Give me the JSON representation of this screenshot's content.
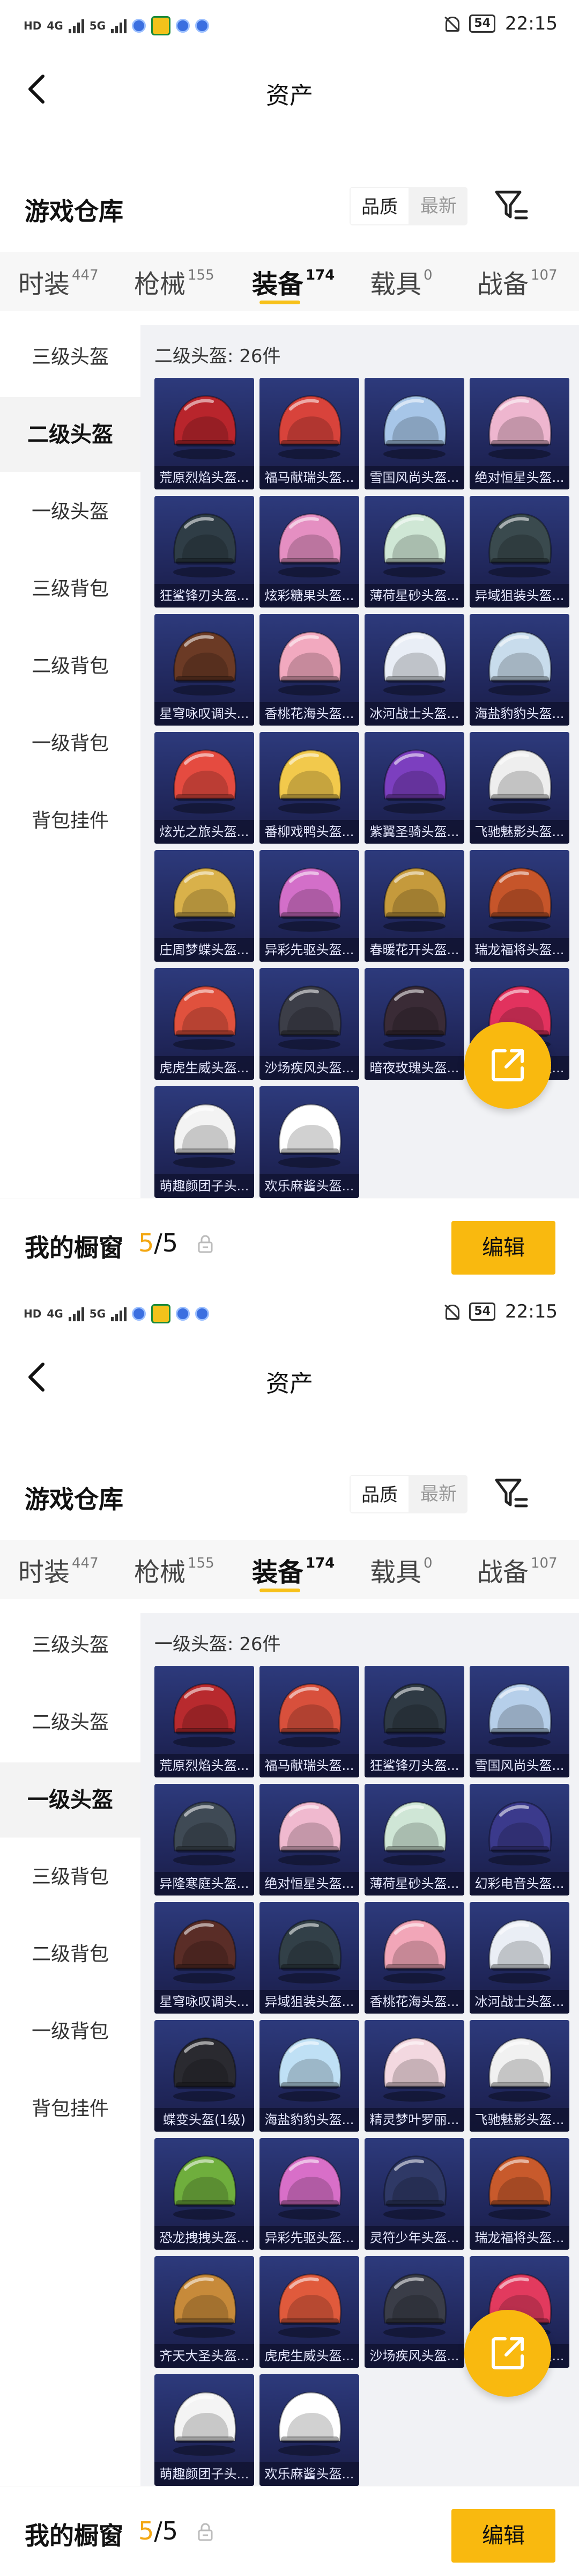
{
  "status_bar": {
    "network_top": "HD",
    "network_bottom": "HD",
    "signal1": "4G",
    "signal2": "5G",
    "battery": "54",
    "time": "22:15"
  },
  "colors": {
    "accent": "#f9b90f",
    "card_bg": "#2d3a7c",
    "count_accent": "#f3a712"
  },
  "screens": [
    {
      "header": {
        "title": "资产"
      },
      "warehouse": {
        "title": "游戏仓库",
        "sort_options": [
          "品质",
          "最新"
        ],
        "active_sort": 0
      },
      "tabs": [
        {
          "label": "时装",
          "count": "447"
        },
        {
          "label": "枪械",
          "count": "155"
        },
        {
          "label": "装备",
          "count": "174"
        },
        {
          "label": "载具",
          "count": "0"
        },
        {
          "label": "战备",
          "count": "107"
        }
      ],
      "active_tab": 2,
      "sidebar": [
        "三级头盔",
        "二级头盔",
        "一级头盔",
        "三级背包",
        "二级背包",
        "一级背包",
        "背包挂件"
      ],
      "active_side": 1,
      "subtitle": "二级头盔: 26件",
      "items": [
        {
          "name": "荒原烈焰头盔...",
          "color": "#b8252c",
          "icon": "helmet-icon"
        },
        {
          "name": "福马献瑞头盔...",
          "color": "#d8433b",
          "icon": "helmet-icon"
        },
        {
          "name": "雪国风尚头盔...",
          "color": "#a7c6e8",
          "icon": "helmet-icon"
        },
        {
          "name": "绝对恒星头盔...",
          "color": "#eeb6cf",
          "icon": "helmet-icon"
        },
        {
          "name": "狂鲨锋刃头盔...",
          "color": "#2f3d46",
          "icon": "helmet-icon"
        },
        {
          "name": "炫彩糖果头盔...",
          "color": "#e58fc2",
          "icon": "helmet-icon"
        },
        {
          "name": "薄荷星砂头盔...",
          "color": "#cfe7d5",
          "icon": "helmet-icon"
        },
        {
          "name": "异域狙装头盔...",
          "color": "#3a4a4e",
          "icon": "helmet-icon"
        },
        {
          "name": "星穹咏叹调头...",
          "color": "#6b3a25",
          "icon": "helmet-icon"
        },
        {
          "name": "香桃花海头盔...",
          "color": "#f2a9bf",
          "icon": "helmet-icon"
        },
        {
          "name": "冰河战士头盔...",
          "color": "#e9eef6",
          "icon": "helmet-icon"
        },
        {
          "name": "海盐豹豹头盔...",
          "color": "#c8dcec",
          "icon": "helmet-icon"
        },
        {
          "name": "炫光之旅头盔...",
          "color": "#e54b40",
          "icon": "helmet-icon"
        },
        {
          "name": "番柳戏鸭头盔...",
          "color": "#f2c94c",
          "icon": "helmet-icon"
        },
        {
          "name": "紫翼圣骑头盔...",
          "color": "#7c3fbf",
          "icon": "helmet-icon"
        },
        {
          "name": "飞驰魅影头盔...",
          "color": "#eeeeee",
          "icon": "helmet-icon"
        },
        {
          "name": "庄周梦蝶头盔...",
          "color": "#d9b14a",
          "icon": "helmet-icon"
        },
        {
          "name": "异彩先驱头盔...",
          "color": "#d36fc9",
          "icon": "helmet-icon"
        },
        {
          "name": "春暖花开头盔...",
          "color": "#c59a3c",
          "icon": "helmet-icon"
        },
        {
          "name": "瑞龙福将头盔...",
          "color": "#c6552a",
          "icon": "helmet-icon"
        },
        {
          "name": "虎虎生威头盔...",
          "color": "#e0513d",
          "icon": "helmet-icon"
        },
        {
          "name": "沙场疾风头盔...",
          "color": "#3c3e48",
          "icon": "helmet-icon"
        },
        {
          "name": "暗夜玫瑰头盔...",
          "color": "#3a2b36",
          "icon": "helmet-icon"
        },
        {
          "name": "时尚暗春头盔...",
          "color": "#e2325e",
          "icon": "helmet-icon"
        },
        {
          "name": "萌趣颜团子头...",
          "color": "#f3f3f3",
          "icon": "helmet-icon"
        },
        {
          "name": "欢乐麻酱头盔...",
          "color": "#ffffff",
          "icon": "helmet-icon"
        }
      ],
      "bottom": {
        "label": "我的橱窗",
        "count_current": "5",
        "count_total": "/5",
        "edit": "编辑"
      }
    },
    {
      "header": {
        "title": "资产"
      },
      "warehouse": {
        "title": "游戏仓库",
        "sort_options": [
          "品质",
          "最新"
        ],
        "active_sort": 0
      },
      "tabs": [
        {
          "label": "时装",
          "count": "447"
        },
        {
          "label": "枪械",
          "count": "155"
        },
        {
          "label": "装备",
          "count": "174"
        },
        {
          "label": "载具",
          "count": "0"
        },
        {
          "label": "战备",
          "count": "107"
        }
      ],
      "active_tab": 2,
      "sidebar": [
        "三级头盔",
        "二级头盔",
        "一级头盔",
        "三级背包",
        "二级背包",
        "一级背包",
        "背包挂件"
      ],
      "active_side": 2,
      "subtitle": "一级头盔: 26件",
      "items": [
        {
          "name": "荒原烈焰头盔...",
          "color": "#b82a2e",
          "icon": "helmet-icon"
        },
        {
          "name": "福马献瑞头盔...",
          "color": "#d8503c",
          "icon": "helmet-icon"
        },
        {
          "name": "狂鲨锋刃头盔...",
          "color": "#2f3a44",
          "icon": "helmet-icon"
        },
        {
          "name": "雪国风尚头盔...",
          "color": "#b6cfea",
          "icon": "helmet-icon"
        },
        {
          "name": "异隆寒庭头盔...",
          "color": "#3f4a55",
          "icon": "helmet-icon"
        },
        {
          "name": "绝对恒星头盔...",
          "color": "#f0b9cf",
          "icon": "helmet-icon"
        },
        {
          "name": "薄荷星砂头盔...",
          "color": "#cfe6d6",
          "icon": "helmet-icon"
        },
        {
          "name": "幻彩电音头盔...",
          "color": "#3b3a8c",
          "icon": "helmet-icon"
        },
        {
          "name": "星穹咏叹调头...",
          "color": "#5a2d27",
          "icon": "helmet-icon"
        },
        {
          "name": "异域狙装头盔...",
          "color": "#324048",
          "icon": "helmet-icon"
        },
        {
          "name": "香桃花海头盔...",
          "color": "#f2a6b8",
          "icon": "helmet-icon"
        },
        {
          "name": "冰河战士头盔...",
          "color": "#eaeef5",
          "icon": "helmet-icon"
        },
        {
          "name": "蝶变头盔(1级)",
          "color": "#2a2a30",
          "icon": "helmet-icon"
        },
        {
          "name": "海盐豹豹头盔...",
          "color": "#bfe0f5",
          "icon": "helmet-icon"
        },
        {
          "name": "精灵梦叶罗丽...",
          "color": "#f3d8e0",
          "icon": "helmet-icon"
        },
        {
          "name": "飞驰魅影头盔...",
          "color": "#f1f1f1",
          "icon": "helmet-icon"
        },
        {
          "name": "恐龙拽拽头盔...",
          "color": "#6fae3d",
          "icon": "helmet-icon"
        },
        {
          "name": "异彩先驱头盔...",
          "color": "#d86fc8",
          "icon": "helmet-icon"
        },
        {
          "name": "灵符少年头盔...",
          "color": "#2f3966",
          "icon": "helmet-icon"
        },
        {
          "name": "瑞龙福将头盔...",
          "color": "#c85a2c",
          "icon": "helmet-icon"
        },
        {
          "name": "齐天大圣头盔...",
          "color": "#c78a3a",
          "icon": "helmet-icon"
        },
        {
          "name": "虎虎生威头盔...",
          "color": "#e05a3c",
          "icon": "helmet-icon"
        },
        {
          "name": "沙场疾风头盔...",
          "color": "#3a3d48",
          "icon": "helmet-icon"
        },
        {
          "name": "时尚暗春头盔...",
          "color": "#e23a5e",
          "icon": "helmet-icon"
        },
        {
          "name": "萌趣颜团子头...",
          "color": "#f4f4f4",
          "icon": "helmet-icon"
        },
        {
          "name": "欢乐麻酱头盔...",
          "color": "#ffffff",
          "icon": "helmet-icon"
        }
      ],
      "bottom": {
        "label": "我的橱窗",
        "count_current": "5",
        "count_total": "/5",
        "edit": "编辑"
      }
    }
  ]
}
